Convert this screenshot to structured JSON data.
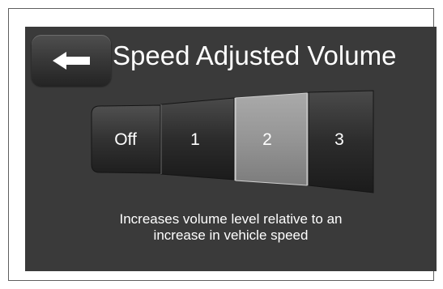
{
  "screen": {
    "title": "Speed Adjusted Volume",
    "back_icon": "left-arrow-icon",
    "options": [
      {
        "label": "Off",
        "selected": false
      },
      {
        "label": "1",
        "selected": false
      },
      {
        "label": "2",
        "selected": true
      },
      {
        "label": "3",
        "selected": false
      }
    ],
    "description_line1": "Increases volume level relative to an",
    "description_line2": "increase in vehicle speed"
  },
  "colors": {
    "background": "#3a3a3a",
    "selected": "#8f8f8f",
    "unselected": "#2e2e2e",
    "text": "#ffffff"
  }
}
